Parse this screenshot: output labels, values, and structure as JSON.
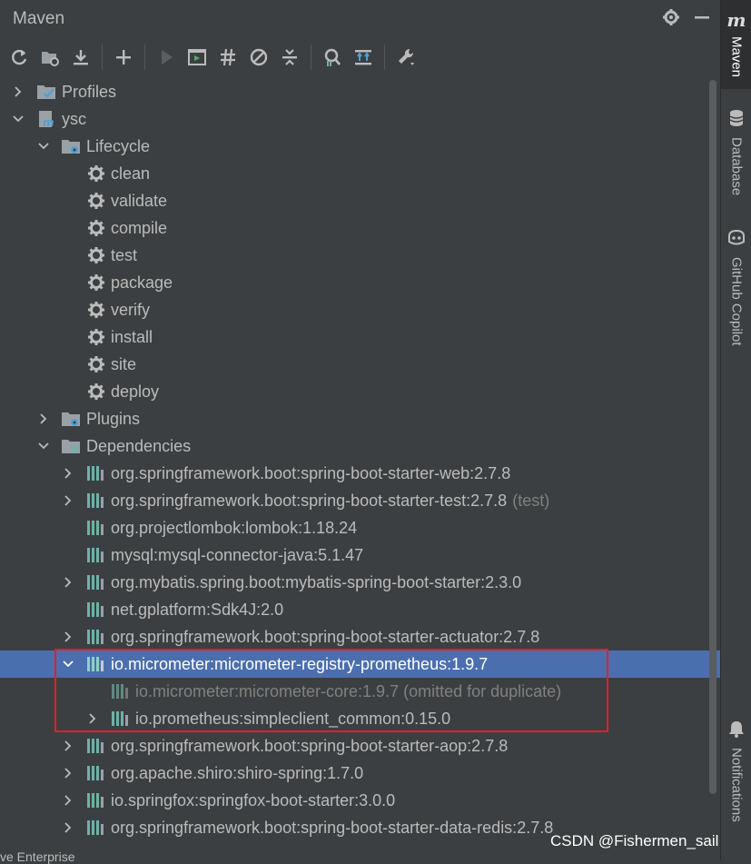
{
  "window": {
    "title": "Maven"
  },
  "sidebar": {
    "logo": "m",
    "tabs": [
      {
        "label": "Maven"
      },
      {
        "label": "Database"
      },
      {
        "label": "GitHub Copilot"
      },
      {
        "label": "Notifications"
      }
    ]
  },
  "tree": {
    "profiles": "Profiles",
    "project": "ysc",
    "lifecycle": "Lifecycle",
    "phases": [
      "clean",
      "validate",
      "compile",
      "test",
      "package",
      "verify",
      "install",
      "site",
      "deploy"
    ],
    "plugins": "Plugins",
    "dependencies": "Dependencies",
    "deps": [
      {
        "label": "org.springframework.boot:spring-boot-starter-web:2.7.8",
        "scope": ""
      },
      {
        "label": "org.springframework.boot:spring-boot-starter-test:2.7.8",
        "scope": "(test)"
      },
      {
        "label": "org.projectlombok:lombok:1.18.24",
        "scope": ""
      },
      {
        "label": "mysql:mysql-connector-java:5.1.47",
        "scope": ""
      },
      {
        "label": "org.mybatis.spring.boot:mybatis-spring-boot-starter:2.3.0",
        "scope": ""
      },
      {
        "label": "net.gplatform:Sdk4J:2.0",
        "scope": ""
      },
      {
        "label": "org.springframework.boot:spring-boot-starter-actuator:2.7.8",
        "scope": ""
      },
      {
        "label": "io.micrometer:micrometer-registry-prometheus:1.9.7",
        "scope": ""
      },
      {
        "label": "io.micrometer:micrometer-core:1.9.7 (omitted for duplicate)",
        "scope": ""
      },
      {
        "label": "io.prometheus:simpleclient_common:0.15.0",
        "scope": ""
      },
      {
        "label": "org.springframework.boot:spring-boot-starter-aop:2.7.8",
        "scope": ""
      },
      {
        "label": "org.apache.shiro:shiro-spring:1.7.0",
        "scope": ""
      },
      {
        "label": "io.springfox:springfox-boot-starter:3.0.0",
        "scope": ""
      },
      {
        "label": "org.springframework.boot:spring-boot-starter-data-redis:2.7.8",
        "scope": ""
      }
    ]
  },
  "footer": {
    "bottom_text": "ve Enterprise",
    "watermark": "CSDN @Fishermen_sail"
  },
  "colors": {
    "panel_bg": "#3c3f41",
    "selection": "#4b6eaf",
    "highlight_box": "#e0202a",
    "dep_icon": "#6bb3a6"
  }
}
